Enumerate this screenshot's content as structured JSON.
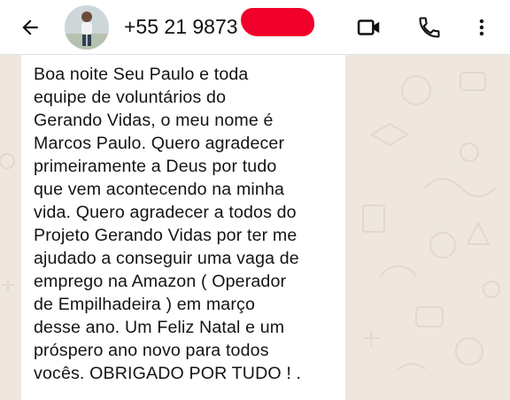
{
  "header": {
    "back_icon": "arrow-left-icon",
    "avatar_icon": "contact-photo",
    "phone_visible": "+55 21 9873",
    "video_icon": "video-camera-icon",
    "call_icon": "phone-icon",
    "menu_icon": "more-vertical-icon"
  },
  "message": {
    "text": "Boa noite Seu Paulo e toda\nequipe de voluntários do\nGerando Vidas, o meu nome é\nMarcos Paulo. Quero agradecer\nprimeiramente a Deus por tudo\nque vem acontecendo na minha\nvida. Quero agradecer a todos do\nProjeto Gerando Vidas por ter me\najudado a conseguir uma vaga de\nemprego na Amazon ( Operador\nde Empilhadeira ) em março\ndesse ano. Um Feliz Natal e um\npróspero ano novo para todos\nvocês. OBRIGADO POR TUDO ! ."
  },
  "colors": {
    "header_bg": "#ffffff",
    "wallpaper": "#efe7de",
    "bubble": "#ffffff",
    "redaction": "#f0002a"
  }
}
